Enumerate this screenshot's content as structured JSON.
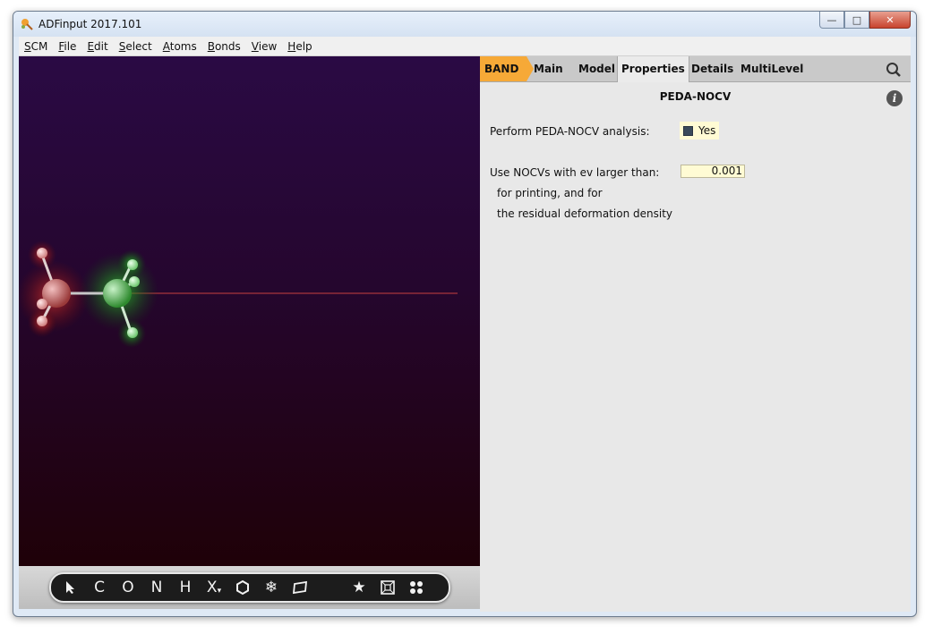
{
  "window": {
    "title": "ADFinput 2017.101",
    "controls": {
      "minimize": "—",
      "maximize": "□",
      "close": "✕"
    }
  },
  "menu": [
    {
      "label": "SCM",
      "hotkey": "S",
      "rest": "CM"
    },
    {
      "label": "File",
      "hotkey": "F",
      "rest": "ile"
    },
    {
      "label": "Edit",
      "hotkey": "E",
      "rest": "dit"
    },
    {
      "label": "Select",
      "hotkey": "S",
      "rest": "elect"
    },
    {
      "label": "Atoms",
      "hotkey": "A",
      "rest": "toms"
    },
    {
      "label": "Bonds",
      "hotkey": "B",
      "rest": "onds"
    },
    {
      "label": "View",
      "hotkey": "V",
      "rest": "iew"
    },
    {
      "label": "Help",
      "hotkey": "H",
      "rest": "elp"
    }
  ],
  "tabs": {
    "band": "BAND",
    "main": "Main",
    "model": "Model",
    "properties": "Properties",
    "details": "Details",
    "multilevel": "MultiLevel"
  },
  "panel": {
    "title": "PEDA-NOCV",
    "info": "i",
    "peda_label": "Perform PEDA-NOCV analysis:",
    "peda_value": "Yes",
    "nocv_label": "Use NOCVs with ev larger than:",
    "nocv_value": "0.001",
    "nocv_line2": "for printing, and for",
    "nocv_line3": "the residual deformation density"
  },
  "toolbar": {
    "select": "arrow-icon",
    "c": "C",
    "o": "O",
    "n": "N",
    "h": "H",
    "x": "X",
    "ring": "hexagon-icon",
    "snowflake": "snowflake-icon",
    "plane": "plane-icon",
    "favorite": "star-icon",
    "frame": "frame-icon",
    "fragments": "fragments-icon"
  },
  "colors": {
    "band_tab": "#f6a937",
    "viewport_top": "#2a0a44",
    "viewport_bottom": "#1f0108",
    "fragment1": "#c23030",
    "fragment2": "#2fa82f"
  }
}
